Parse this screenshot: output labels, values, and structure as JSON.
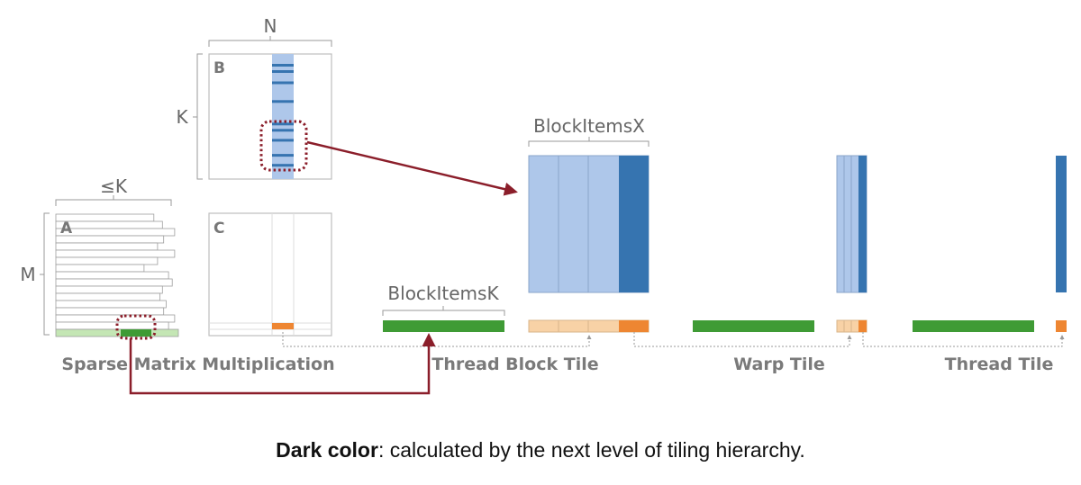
{
  "labels": {
    "n": "N",
    "k": "K",
    "le_k": "≤K",
    "m": "M",
    "block_items_x": "BlockItemsX",
    "block_items_k": "BlockItemsK"
  },
  "panels": {
    "a": "A",
    "b": "B",
    "c": "C"
  },
  "sections": {
    "sparse": "Sparse Matrix Multiplication",
    "thread_block": "Thread Block Tile",
    "warp": "Warp Tile",
    "thread": "Thread Tile"
  },
  "caption": {
    "bold": "Dark color",
    "rest": ": calculated by the next level of tiling hierarchy."
  },
  "colors": {
    "light_blue": "#aec7ea",
    "dark_blue": "#3674b0",
    "green": "#3f9b35",
    "light_green": "#c4e6b4",
    "orange": "#ee8632",
    "light_orange": "#f8d2a6",
    "dark_red": "#8b1e2a"
  },
  "matrix_a": {
    "row_lengths": [
      0.8,
      0.87,
      0.97,
      0.88,
      0.83,
      0.97,
      0.83,
      0.72,
      0.92,
      0.95,
      0.87,
      0.85,
      0.9,
      0.88,
      0.97,
      0.92,
      1.0
    ]
  },
  "matrix_b": {
    "nonzero_rows": [
      0.09,
      0.14,
      0.23,
      0.38,
      0.56,
      0.61,
      0.69,
      0.81,
      0.89
    ]
  }
}
